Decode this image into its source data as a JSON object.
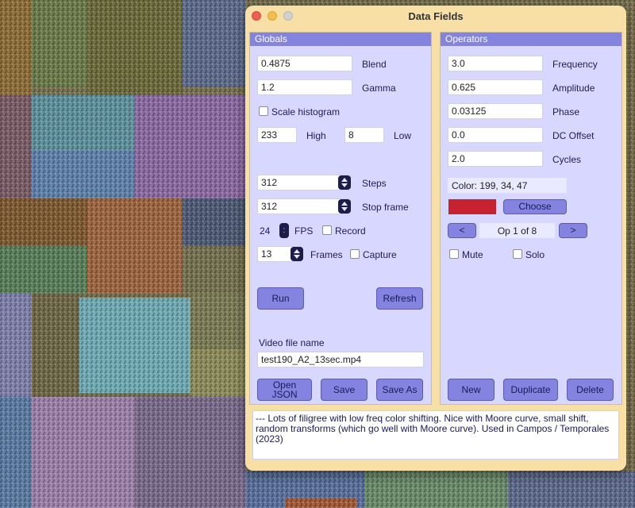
{
  "window": {
    "title": "Data Fields"
  },
  "globals": {
    "header": "Globals",
    "blend": {
      "value": "0.4875",
      "label": "Blend"
    },
    "gamma": {
      "value": "1.2",
      "label": "Gamma"
    },
    "scale_histogram": {
      "label": "Scale histogram",
      "checked": false
    },
    "high": {
      "value": "233",
      "label": "High"
    },
    "low": {
      "value": "8",
      "label": "Low"
    },
    "steps": {
      "value": "312",
      "label": "Steps"
    },
    "stop_frame": {
      "value": "312",
      "label": "Stop frame"
    },
    "fps": {
      "value": "24",
      "label": "FPS"
    },
    "record": {
      "label": "Record",
      "checked": false
    },
    "frames": {
      "value": "13",
      "label": "Frames"
    },
    "capture": {
      "label": "Capture",
      "checked": false
    },
    "run_label": "Run",
    "refresh_label": "Refresh",
    "video_label": "Video file name",
    "video_value": "test190_A2_13sec.mp4",
    "open_json_line1": "Open",
    "open_json_line2": "JSON",
    "save_label": "Save",
    "save_as_label": "Save As"
  },
  "operators": {
    "header": "Operators",
    "frequency": {
      "value": "3.0",
      "label": "Frequency"
    },
    "amplitude": {
      "value": "0.625",
      "label": "Amplitude"
    },
    "phase": {
      "value": "0.03125",
      "label": "Phase"
    },
    "dc_offset": {
      "value": "0.0",
      "label": "DC Offset"
    },
    "cycles": {
      "value": "2.0",
      "label": "Cycles"
    },
    "color_text": "Color: 199, 34, 47",
    "swatch_color": "#c7222f",
    "choose_label": "Choose",
    "prev_label": "<",
    "next_label": ">",
    "op_index": "Op 1 of 8",
    "mute": {
      "label": "Mute",
      "checked": false
    },
    "solo": {
      "label": "Solo",
      "checked": false
    },
    "new_label": "New",
    "duplicate_label": "Duplicate",
    "delete_label": "Delete"
  },
  "notes_text": "--- Lots of filigree with low freq color shifting. Nice with Moore curve, small shift, random transforms (which go well with Moore curve). Used in Campos / Temporales (2023)",
  "colors": {
    "panel_bg": "#d7d7ff",
    "header_bg": "#8484e0",
    "window_bg": "#f7dfa6",
    "button_bg": "#8484e0"
  }
}
